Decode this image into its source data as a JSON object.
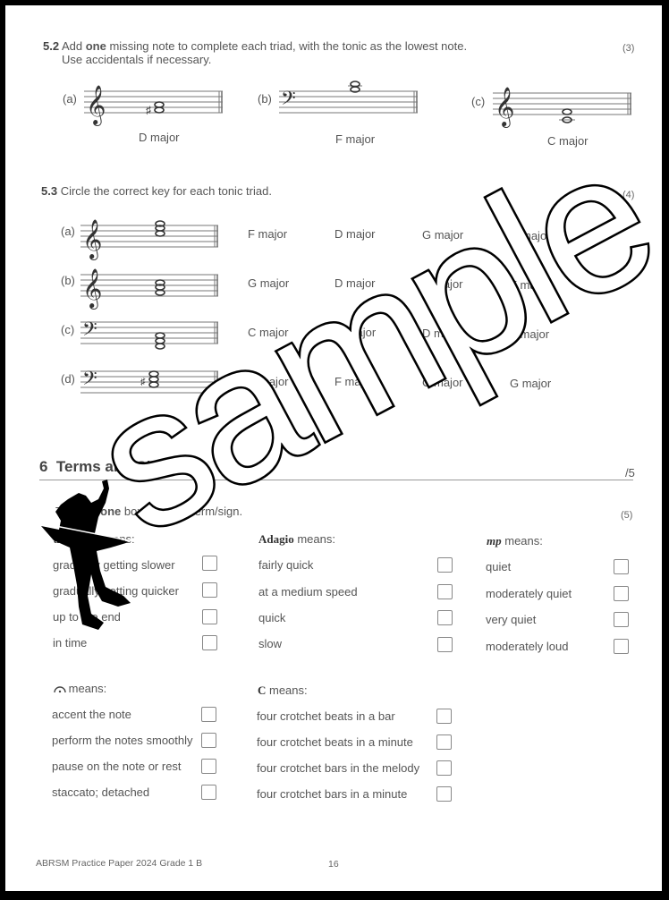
{
  "q52": {
    "number": "5.2",
    "text_pre": "Add ",
    "text_bold": "one",
    "text_post": " missing note to complete each triad, with the tonic as the lowest note.",
    "text_line2": "Use accidentals if necessary.",
    "marks": "(3)",
    "items": [
      {
        "label": "(a)",
        "clef": "treble",
        "key": "D major"
      },
      {
        "label": "(b)",
        "clef": "bass",
        "key": "F major"
      },
      {
        "label": "(c)",
        "clef": "treble",
        "key": "C major"
      }
    ]
  },
  "q53": {
    "number": "5.3",
    "text": "Circle the correct key for each tonic triad.",
    "marks": "(4)",
    "items": [
      {
        "label": "(a)",
        "clef": "treble",
        "options": [
          "F major",
          "D major",
          "G major",
          "C major"
        ]
      },
      {
        "label": "(b)",
        "clef": "treble",
        "options": [
          "G major",
          "D major",
          "C major",
          "F major"
        ]
      },
      {
        "label": "(c)",
        "clef": "bass",
        "options": [
          "C major",
          "G major",
          "D major",
          "F major"
        ]
      },
      {
        "label": "(d)",
        "clef": "bass",
        "options": [
          "D major",
          "F major",
          "C major",
          "G major"
        ]
      }
    ]
  },
  "section6": {
    "number": "6",
    "title": "Terms and Signs",
    "score": "/5",
    "instruction_pre": "Tick (✓) ",
    "instruction_bold": "one",
    "instruction_post": " box for each term/sign.",
    "marks": "(5)",
    "groups": [
      {
        "term": "a tempo",
        "suffix": " means:",
        "options": [
          "gradually getting slower",
          "gradually getting quicker",
          "up to the end",
          "in time"
        ]
      },
      {
        "term": "Adagio",
        "suffix": " means:",
        "options": [
          "fairly quick",
          "at a medium speed",
          "quick",
          "slow"
        ]
      },
      {
        "term": "mp",
        "suffix": " means:",
        "options": [
          "quiet",
          "moderately quiet",
          "very quiet",
          "moderately loud"
        ]
      },
      {
        "term": "𝄐",
        "suffix": " means:",
        "options": [
          "accent the note",
          "perform the notes smoothly",
          "pause on the note or rest",
          "staccato; detached"
        ]
      },
      {
        "term": "C",
        "suffix": " means:",
        "options": [
          "four crotchet beats in a bar",
          "four crotchet beats in a minute",
          "four crotchet bars in the melody",
          "four crotchet bars in a minute"
        ]
      }
    ]
  },
  "footer": {
    "title": "ABRSM Practice Paper 2024 Grade 1 B",
    "page": "16"
  },
  "watermark": {
    "text": "sample"
  }
}
